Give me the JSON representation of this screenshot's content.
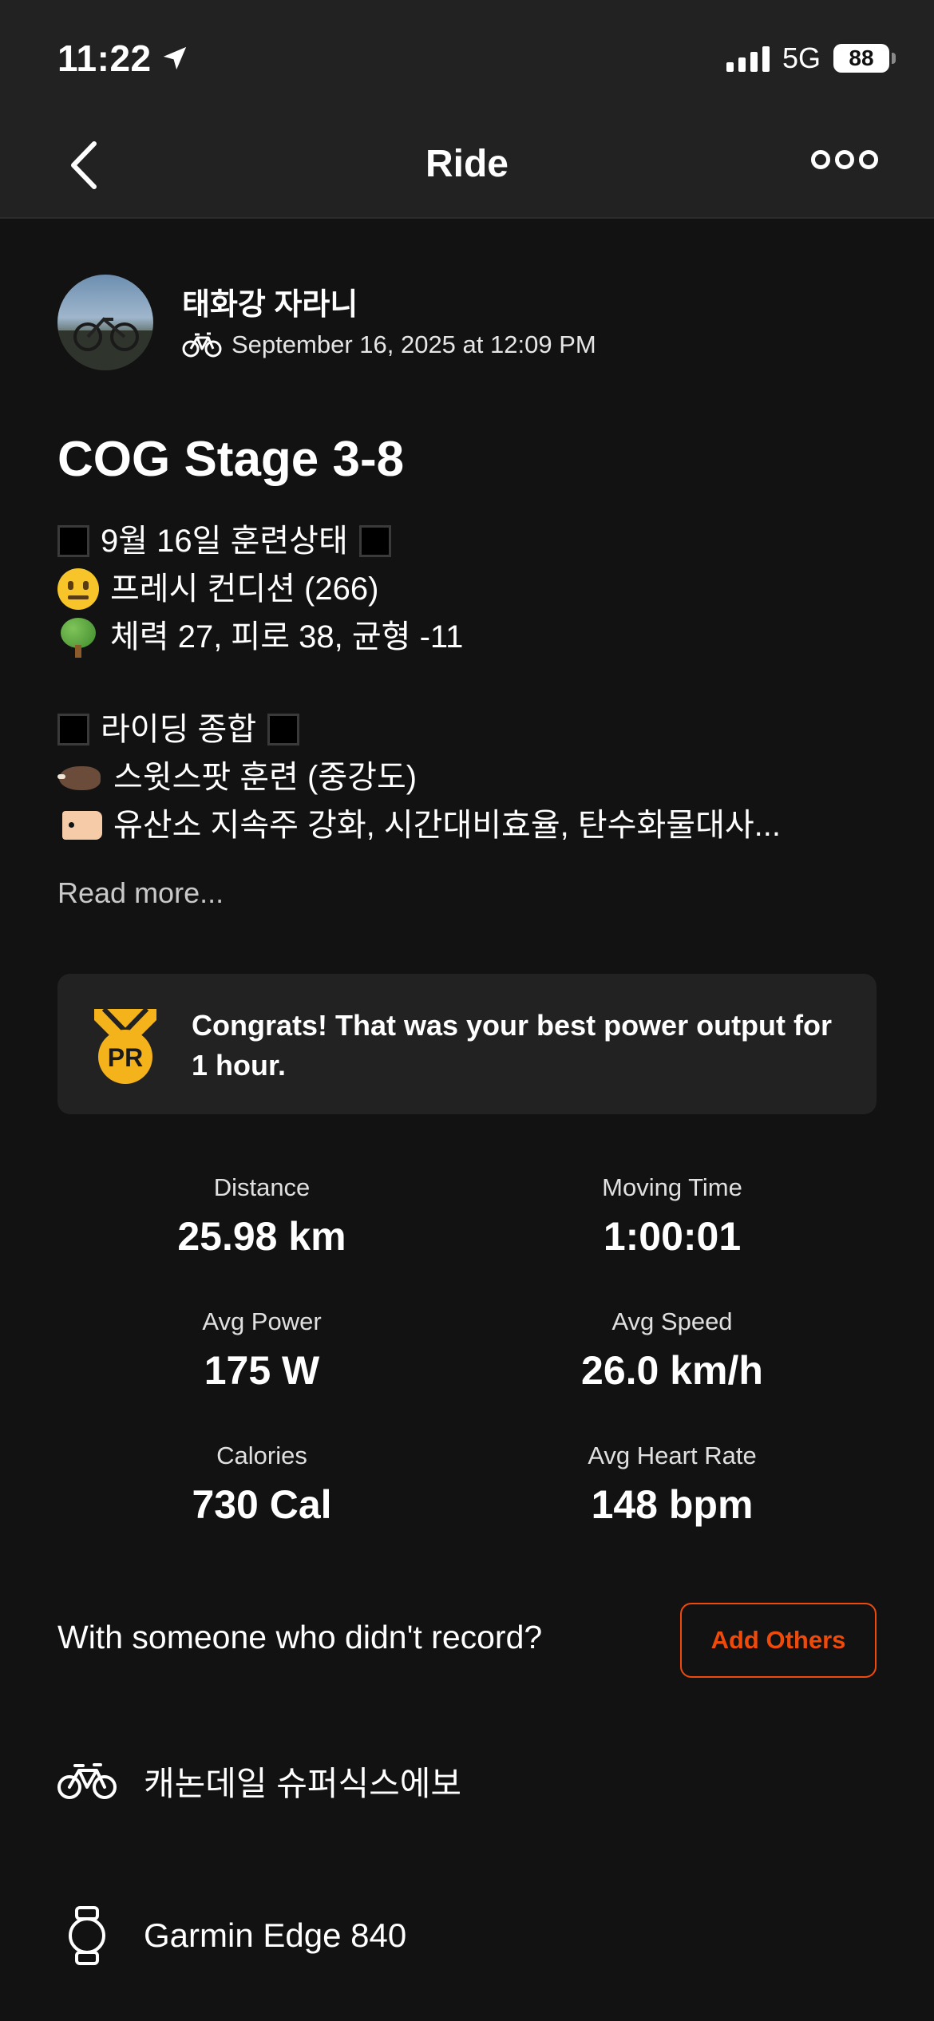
{
  "status_bar": {
    "time": "11:22",
    "network": "5G",
    "battery": "88"
  },
  "nav": {
    "title": "Ride"
  },
  "athlete": {
    "name": "태화강 자라니",
    "date": "September 16, 2025 at 12:09 PM"
  },
  "activity": {
    "title": "COG Stage 3-8",
    "description": [
      "9월 16일 훈련상태",
      "프레시 컨디션 (266)",
      "체력 27, 피로 38, 균형 -11",
      "라이딩 종합",
      "스윗스팟 훈련 (중강도)",
      "유산소 지속주 강화, 시간대비효율, 탄수화물대사..."
    ],
    "read_more": "Read more..."
  },
  "achievement": {
    "badge": "PR",
    "text": "Congrats! That was your best power output for 1 hour."
  },
  "stats": [
    {
      "label": "Distance",
      "value": "25.98 km"
    },
    {
      "label": "Moving Time",
      "value": "1:00:01"
    },
    {
      "label": "Avg Power",
      "value": "175 W"
    },
    {
      "label": "Avg Speed",
      "value": "26.0 km/h"
    },
    {
      "label": "Calories",
      "value": "730 Cal"
    },
    {
      "label": "Avg Heart Rate",
      "value": "148 bpm"
    }
  ],
  "with_others": {
    "prompt": "With someone who didn't record?",
    "button": "Add Others"
  },
  "gear": {
    "bike": "캐논데일 슈퍼식스에보",
    "device": "Garmin Edge 840"
  },
  "colors": {
    "accent": "#f04a0b",
    "background": "#121212",
    "card": "#222222",
    "badge": "#f5b31b"
  }
}
